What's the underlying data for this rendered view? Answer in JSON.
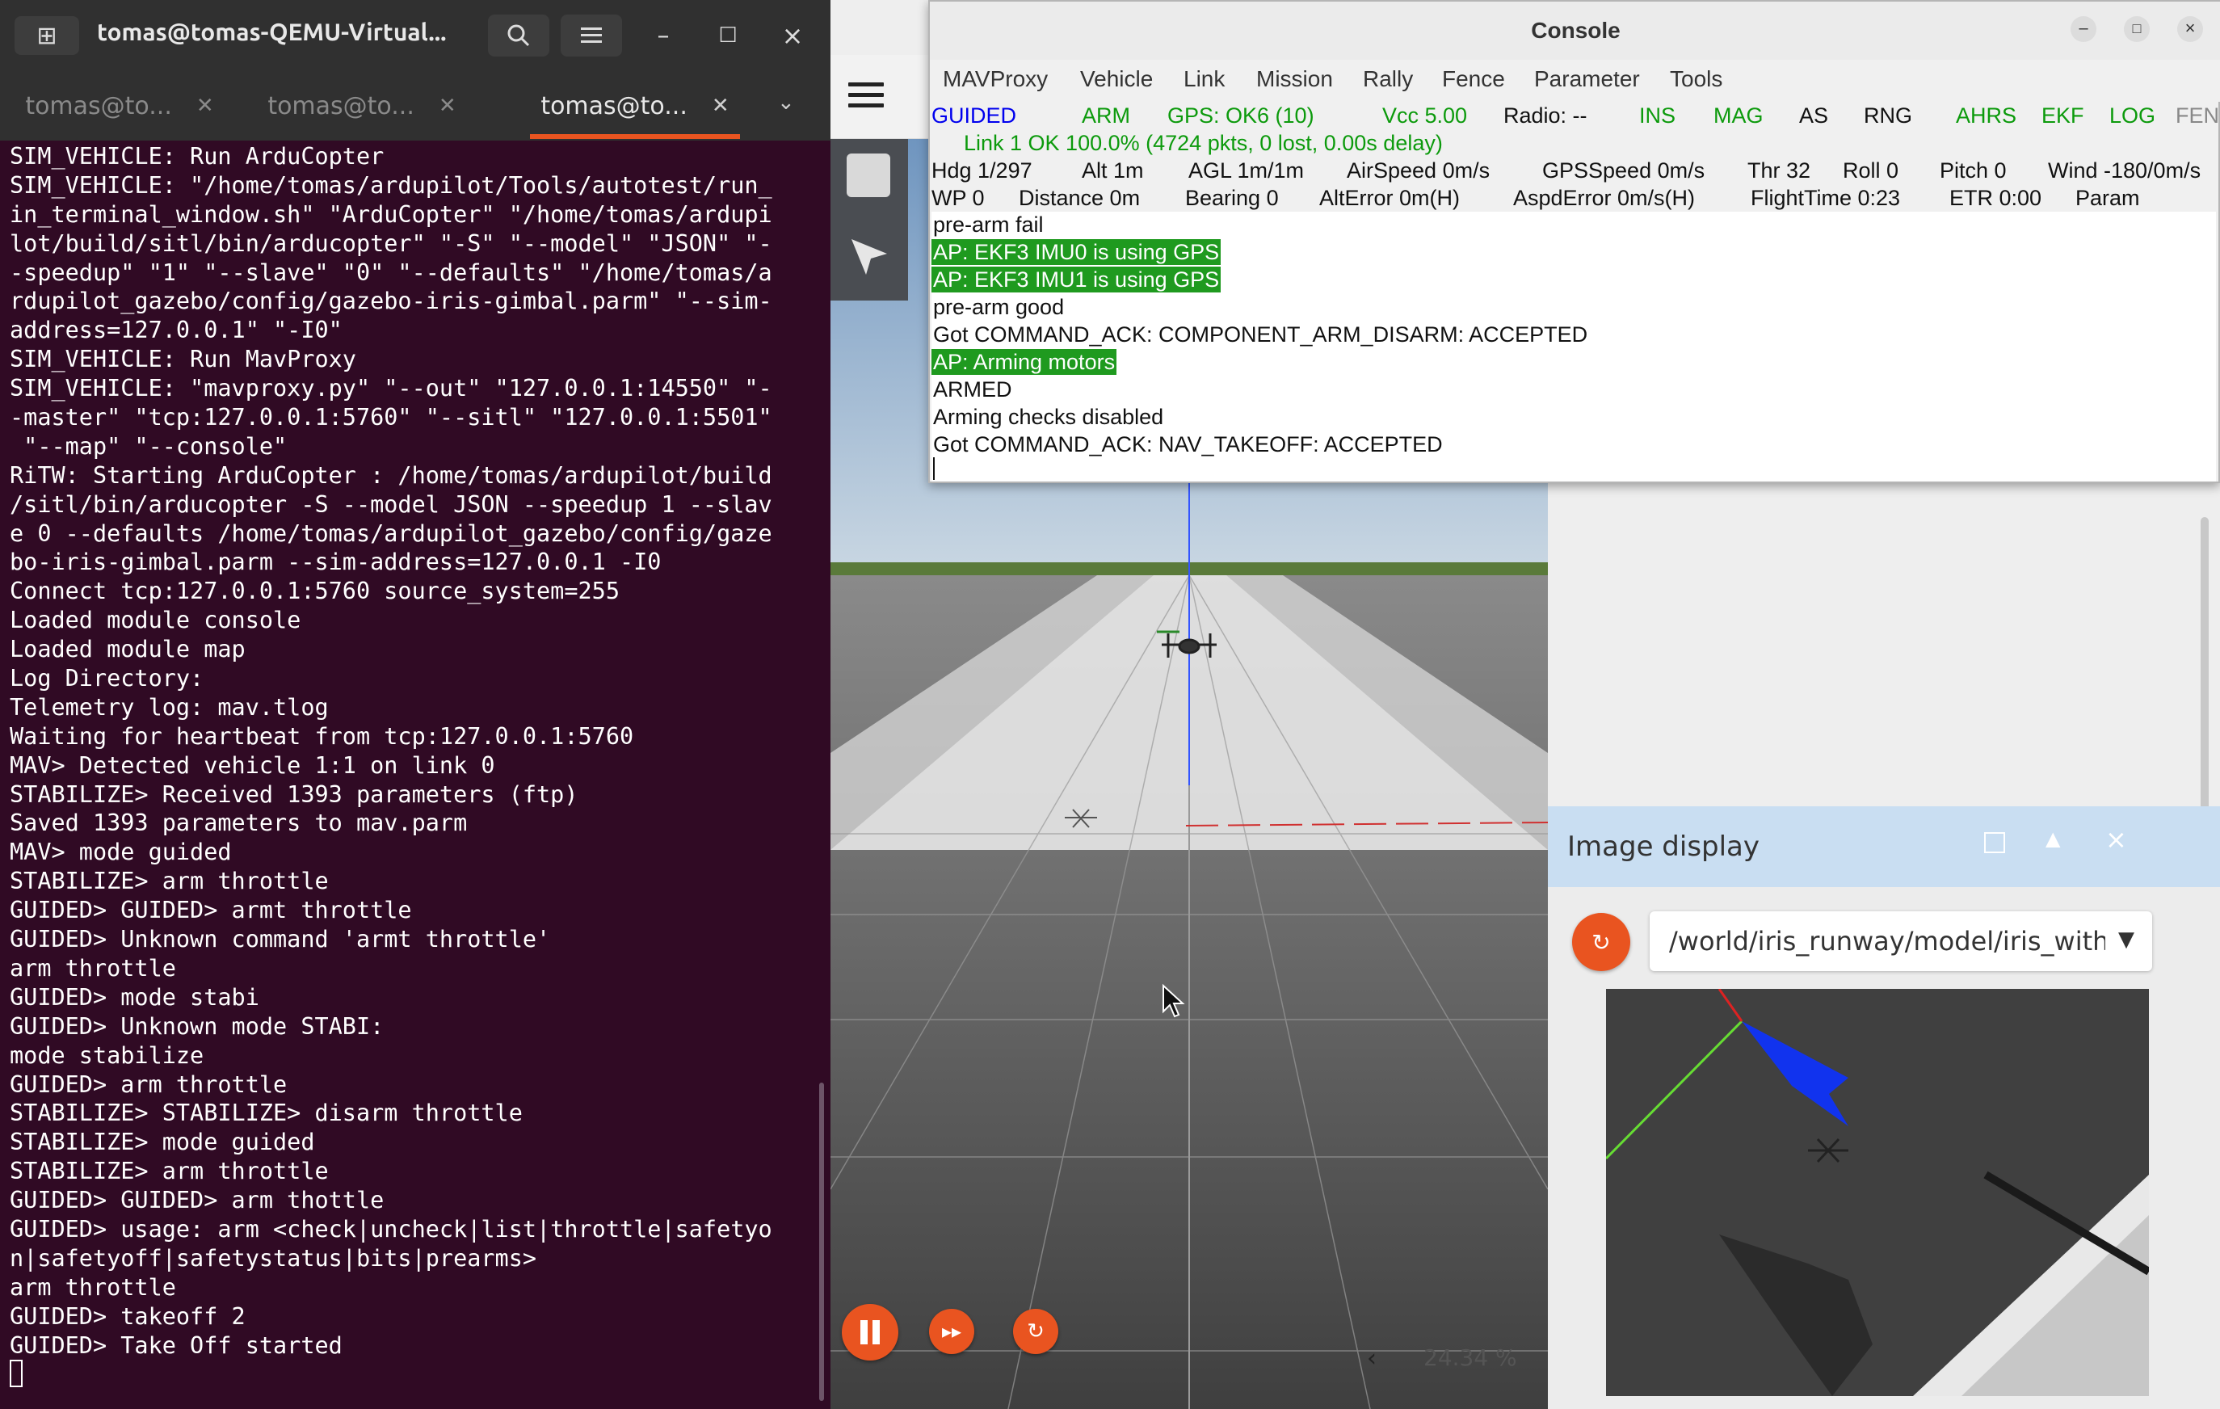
{
  "terminal": {
    "title": "tomas@tomas-QEMU-Virtual...",
    "tabs": [
      "tomas@to...",
      "tomas@to...",
      "tomas@to..."
    ],
    "lines": [
      "SIM_VEHICLE: Run ArduCopter",
      "SIM_VEHICLE: \"/home/tomas/ardupilot/Tools/autotest/run_",
      "in_terminal_window.sh\" \"ArduCopter\" \"/home/tomas/ardupi",
      "lot/build/sitl/bin/arducopter\" \"-S\" \"--model\" \"JSON\" \"-",
      "-speedup\" \"1\" \"--slave\" \"0\" \"--defaults\" \"/home/tomas/a",
      "rdupilot_gazebo/config/gazebo-iris-gimbal.parm\" \"--sim-",
      "address=127.0.0.1\" \"-I0\"",
      "SIM_VEHICLE: Run MavProxy",
      "SIM_VEHICLE: \"mavproxy.py\" \"--out\" \"127.0.0.1:14550\" \"-",
      "-master\" \"tcp:127.0.0.1:5760\" \"--sitl\" \"127.0.0.1:5501\"",
      " \"--map\" \"--console\"",
      "RiTW: Starting ArduCopter : /home/tomas/ardupilot/build",
      "/sitl/bin/arducopter -S --model JSON --speedup 1 --slav",
      "e 0 --defaults /home/tomas/ardupilot_gazebo/config/gaze",
      "bo-iris-gimbal.parm --sim-address=127.0.0.1 -I0",
      "Connect tcp:127.0.0.1:5760 source_system=255",
      "Loaded module console",
      "Loaded module map",
      "Log Directory:",
      "Telemetry log: mav.tlog",
      "Waiting for heartbeat from tcp:127.0.0.1:5760",
      "MAV> Detected vehicle 1:1 on link 0",
      "STABILIZE> Received 1393 parameters (ftp)",
      "Saved 1393 parameters to mav.parm",
      "MAV> mode guided",
      "STABILIZE> arm throttle",
      "GUIDED> GUIDED> armt throttle",
      "GUIDED> Unknown command 'armt throttle'",
      "arm throttle",
      "GUIDED> mode stabi",
      "GUIDED> Unknown mode STABI:",
      "mode stabilize",
      "GUIDED> arm throttle",
      "STABILIZE> STABILIZE> disarm throttle",
      "STABILIZE> mode guided",
      "STABILIZE> arm throttle",
      "GUIDED> GUIDED> arm thottle",
      "GUIDED> usage: arm <check|uncheck|list|throttle|safetyo",
      "n|safetyoff|safetystatus|bits|prearms>",
      "arm throttle",
      "GUIDED> takeoff 2",
      "GUIDED> Take Off started"
    ]
  },
  "console": {
    "title": "Console",
    "menu": [
      "MAVProxy",
      "Vehicle",
      "Link",
      "Mission",
      "Rally",
      "Fence",
      "Parameter",
      "Tools"
    ],
    "status_row1": [
      "GUIDED",
      "ARM",
      "GPS: OK6 (10)",
      "Vcc 5.00",
      "Radio: --",
      "INS",
      "MAG",
      "AS",
      "RNG",
      "AHRS",
      "EKF",
      "LOG",
      "FEN"
    ],
    "status_row2": "Link 1 OK 100.0% (4724 pkts, 0 lost, 0.00s delay)",
    "status_row3": [
      "Hdg  1/297",
      "Alt 1m",
      "AGL 1m/1m",
      "AirSpeed 0m/s",
      "GPSSpeed 0m/s",
      "Thr 32",
      "Roll 0",
      "Pitch 0",
      "Wind -180/0m/s"
    ],
    "status_row4": [
      "WP 0",
      "Distance 0m",
      "Bearing 0",
      "AltError 0m(H)",
      "AspdError 0m/s(H)",
      "FlightTime 0:23",
      "ETR 0:00",
      "Param"
    ],
    "log": [
      "pre-arm fail",
      "AP: EKF3 IMU0 is using GPS",
      "AP: EKF3 IMU1 is using GPS",
      "pre-arm good",
      "Got COMMAND_ACK: COMPONENT_ARM_DISARM: ACCEPTED",
      "AP: Arming motors",
      "ARMED",
      "Arming checks disabled",
      "Got COMMAND_ACK: NAV_TAKEOFF: ACCEPTED"
    ],
    "colors": {
      "green": "#0c9a0c",
      "blue": "#0000ee",
      "highlight": "#1f9a1f"
    }
  },
  "gazebo": {
    "rtf": "24.34 %",
    "image_display": {
      "title": "Image display",
      "topic": "/world/iris_runway/model/iris_with_"
    },
    "accent": "#e95420"
  }
}
